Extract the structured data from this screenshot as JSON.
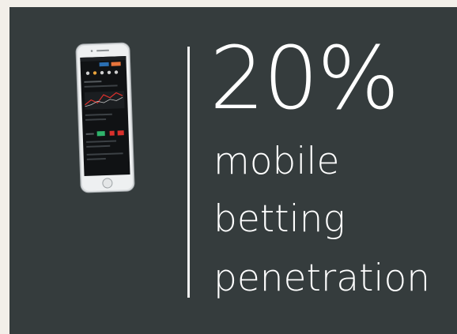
{
  "headline": {
    "value": "20%",
    "lines": [
      "mobile",
      "betting",
      "penetration"
    ]
  },
  "colors": {
    "background": "#353c3d",
    "border": "#f2efe9",
    "text": "#ffffff",
    "accent_orange": "#e8743b",
    "accent_green": "#2fb36b",
    "accent_red": "#d9302c"
  },
  "illustration": {
    "icon": "smartphone-icon"
  }
}
